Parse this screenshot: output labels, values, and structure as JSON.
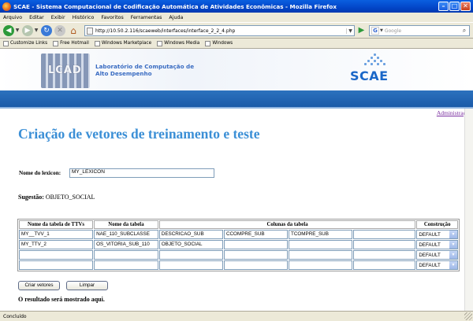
{
  "window": {
    "title": "SCAE - Sistema Computacional de Codificação Automática de Atividades Econômicas - Mozilla Firefox"
  },
  "menu": [
    "Arquivo",
    "Editar",
    "Exibir",
    "Histórico",
    "Favoritos",
    "Ferramentas",
    "Ajuda"
  ],
  "nav": {
    "url": "http://10.50.2.116/scaeweb/interfaces/interface_2_2_4.php",
    "search_placeholder": "Google"
  },
  "bookmarks": [
    "Customize Links",
    "Free Hotmail",
    "Windows Marketplace",
    "Windows Media",
    "Windows"
  ],
  "banner": {
    "logo_word": "LCAD",
    "lab_line1": "Laboratório de Computação de",
    "lab_line2": "Alto Desempenho",
    "scae_logo": "SCAE"
  },
  "page": {
    "admin_link": "Administração",
    "title": "Criação de vetores de treinamento e teste",
    "lexicon_label": "Nome do lexicon:",
    "lexicon_value": "MY_LEXICON",
    "suggestion_label": "Sugestão:",
    "suggestion_value": "OBJETO_SOCIAL",
    "table": {
      "headers": [
        "Nome da tabela de TTVs",
        "Nome da tabela",
        "Colunas da tabela",
        "Construção"
      ],
      "rows": [
        [
          "MY__TVV_1",
          "NAE_110_SUBCLASSE",
          "DESCRICAO_SUB",
          "CCOMPRE_SUB",
          "TCOMPRE_SUB",
          "",
          "DEFAULT"
        ],
        [
          "MY_TTV_2",
          "OS_VITORIA_SUB_110",
          "OBJETO_SOCIAL",
          "",
          "",
          "",
          "DEFAULT"
        ],
        [
          "",
          "",
          "",
          "",
          "",
          "",
          "DEFAULT"
        ],
        [
          "",
          "",
          "",
          "",
          "",
          "",
          "DEFAULT"
        ]
      ]
    },
    "create_button": "Criar vetores",
    "clear_button": "Limpar",
    "result_text": "O resultado será mostrado aqui."
  },
  "status": {
    "text": "Concluído"
  }
}
